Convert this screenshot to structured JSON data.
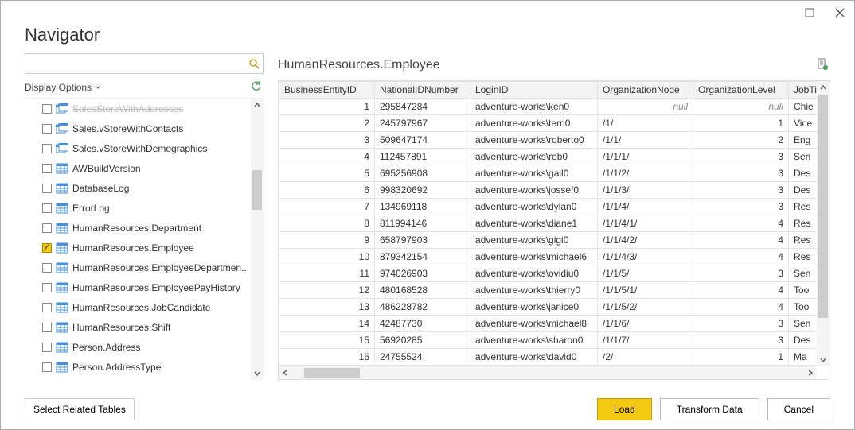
{
  "window": {
    "title": "Navigator"
  },
  "left": {
    "search_placeholder": "",
    "display_options_label": "Display Options",
    "tree": [
      {
        "checked": false,
        "type": "view",
        "label": "SalesStoreWithAddresses",
        "faded": true
      },
      {
        "checked": false,
        "type": "view",
        "label": "Sales.vStoreWithContacts"
      },
      {
        "checked": false,
        "type": "view",
        "label": "Sales.vStoreWithDemographics"
      },
      {
        "checked": false,
        "type": "table",
        "label": "AWBuildVersion"
      },
      {
        "checked": false,
        "type": "table",
        "label": "DatabaseLog"
      },
      {
        "checked": false,
        "type": "table",
        "label": "ErrorLog"
      },
      {
        "checked": false,
        "type": "table",
        "label": "HumanResources.Department"
      },
      {
        "checked": true,
        "type": "table",
        "label": "HumanResources.Employee"
      },
      {
        "checked": false,
        "type": "table",
        "label": "HumanResources.EmployeeDepartmen..."
      },
      {
        "checked": false,
        "type": "table",
        "label": "HumanResources.EmployeePayHistory"
      },
      {
        "checked": false,
        "type": "table",
        "label": "HumanResources.JobCandidate"
      },
      {
        "checked": false,
        "type": "table",
        "label": "HumanResources.Shift"
      },
      {
        "checked": false,
        "type": "table",
        "label": "Person.Address"
      },
      {
        "checked": false,
        "type": "table",
        "label": "Person.AddressType"
      }
    ]
  },
  "right": {
    "title": "HumanResources.Employee",
    "columns": [
      "BusinessEntityID",
      "NationalIDNumber",
      "LoginID",
      "OrganizationNode",
      "OrganizationLevel",
      "JobTitle"
    ],
    "rows": [
      {
        "BusinessEntityID": "1",
        "NationalIDNumber": "295847284",
        "LoginID": "adventure-works\\ken0",
        "OrganizationNode": "null",
        "OrganizationLevel": "null",
        "JobTitle": "Chie",
        "orgNull": true,
        "lvlNull": true
      },
      {
        "BusinessEntityID": "2",
        "NationalIDNumber": "245797967",
        "LoginID": "adventure-works\\terri0",
        "OrganizationNode": "/1/",
        "OrganizationLevel": "1",
        "JobTitle": "Vice"
      },
      {
        "BusinessEntityID": "3",
        "NationalIDNumber": "509647174",
        "LoginID": "adventure-works\\roberto0",
        "OrganizationNode": "/1/1/",
        "OrganizationLevel": "2",
        "JobTitle": "Eng"
      },
      {
        "BusinessEntityID": "4",
        "NationalIDNumber": "112457891",
        "LoginID": "adventure-works\\rob0",
        "OrganizationNode": "/1/1/1/",
        "OrganizationLevel": "3",
        "JobTitle": "Sen"
      },
      {
        "BusinessEntityID": "5",
        "NationalIDNumber": "695256908",
        "LoginID": "adventure-works\\gail0",
        "OrganizationNode": "/1/1/2/",
        "OrganizationLevel": "3",
        "JobTitle": "Des"
      },
      {
        "BusinessEntityID": "6",
        "NationalIDNumber": "998320692",
        "LoginID": "adventure-works\\jossef0",
        "OrganizationNode": "/1/1/3/",
        "OrganizationLevel": "3",
        "JobTitle": "Des"
      },
      {
        "BusinessEntityID": "7",
        "NationalIDNumber": "134969118",
        "LoginID": "adventure-works\\dylan0",
        "OrganizationNode": "/1/1/4/",
        "OrganizationLevel": "3",
        "JobTitle": "Res"
      },
      {
        "BusinessEntityID": "8",
        "NationalIDNumber": "811994146",
        "LoginID": "adventure-works\\diane1",
        "OrganizationNode": "/1/1/4/1/",
        "OrganizationLevel": "4",
        "JobTitle": "Res"
      },
      {
        "BusinessEntityID": "9",
        "NationalIDNumber": "658797903",
        "LoginID": "adventure-works\\gigi0",
        "OrganizationNode": "/1/1/4/2/",
        "OrganizationLevel": "4",
        "JobTitle": "Res"
      },
      {
        "BusinessEntityID": "10",
        "NationalIDNumber": "879342154",
        "LoginID": "adventure-works\\michael6",
        "OrganizationNode": "/1/1/4/3/",
        "OrganizationLevel": "4",
        "JobTitle": "Res"
      },
      {
        "BusinessEntityID": "11",
        "NationalIDNumber": "974026903",
        "LoginID": "adventure-works\\ovidiu0",
        "OrganizationNode": "/1/1/5/",
        "OrganizationLevel": "3",
        "JobTitle": "Sen"
      },
      {
        "BusinessEntityID": "12",
        "NationalIDNumber": "480168528",
        "LoginID": "adventure-works\\thierry0",
        "OrganizationNode": "/1/1/5/1/",
        "OrganizationLevel": "4",
        "JobTitle": "Too"
      },
      {
        "BusinessEntityID": "13",
        "NationalIDNumber": "486228782",
        "LoginID": "adventure-works\\janice0",
        "OrganizationNode": "/1/1/5/2/",
        "OrganizationLevel": "4",
        "JobTitle": "Too"
      },
      {
        "BusinessEntityID": "14",
        "NationalIDNumber": "42487730",
        "LoginID": "adventure-works\\michael8",
        "OrganizationNode": "/1/1/6/",
        "OrganizationLevel": "3",
        "JobTitle": "Sen"
      },
      {
        "BusinessEntityID": "15",
        "NationalIDNumber": "56920285",
        "LoginID": "adventure-works\\sharon0",
        "OrganizationNode": "/1/1/7/",
        "OrganizationLevel": "3",
        "JobTitle": "Des"
      },
      {
        "BusinessEntityID": "16",
        "NationalIDNumber": "24755524",
        "LoginID": "adventure-works\\david0",
        "OrganizationNode": "/2/",
        "OrganizationLevel": "1",
        "JobTitle": "Ma"
      }
    ]
  },
  "footer": {
    "select_related": "Select Related Tables",
    "load": "Load",
    "transform": "Transform Data",
    "cancel": "Cancel"
  }
}
